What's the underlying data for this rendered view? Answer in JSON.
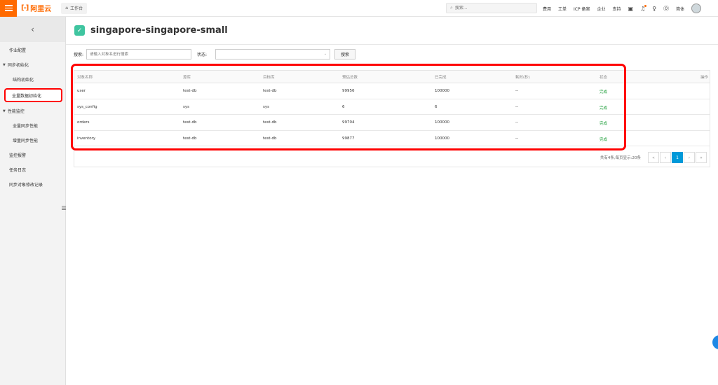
{
  "topbar": {
    "brand": "阿里云",
    "brand_icon": "[-]",
    "workbench": "工作台",
    "search_placeholder": "搜索...",
    "nav": [
      "费用",
      "工单",
      "ICP 备案",
      "企业",
      "支持"
    ],
    "user": "简体",
    "accent": "#ff6a00"
  },
  "sidebar": {
    "items": [
      {
        "label": "作业配置"
      },
      {
        "label": "同步初始化"
      },
      {
        "label": "结构初始化"
      },
      {
        "label": "全量数据初始化"
      },
      {
        "label": "性能监控"
      },
      {
        "label": "全量同步性能"
      },
      {
        "label": "增量同步性能"
      },
      {
        "label": "监控报警"
      },
      {
        "label": "任务日志"
      },
      {
        "label": "同步对象修改记录"
      }
    ]
  },
  "main": {
    "title": "singapore-singapore-small",
    "filters": {
      "search_label": "搜索:",
      "search_placeholder": "请输入对象名进行搜索",
      "status_label": "状态:",
      "status_value": "",
      "search_button": "搜索"
    },
    "table": {
      "headers": [
        "对象名称",
        "源库",
        "目标库",
        "预估总数",
        "已完成",
        "耗时(秒)",
        "状态",
        "操作"
      ],
      "rows": [
        {
          "name": "user",
          "source": "test-db",
          "target": "test-db",
          "estimated": "99956",
          "done": "100000",
          "time": "--",
          "status": "完成"
        },
        {
          "name": "sys_config",
          "source": "sys",
          "target": "sys",
          "estimated": "6",
          "done": "6",
          "time": "--",
          "status": "完成"
        },
        {
          "name": "orders",
          "source": "test-db",
          "target": "test-db",
          "estimated": "99704",
          "done": "100000",
          "time": "--",
          "status": "完成"
        },
        {
          "name": "inventory",
          "source": "test-db",
          "target": "test-db",
          "estimated": "99877",
          "done": "100000",
          "time": "--",
          "status": "完成"
        }
      ]
    },
    "pagination": {
      "summary": "共有4条,每页显示:20条",
      "first": "«",
      "prev": "‹",
      "current": "1",
      "next": "›",
      "last": "»"
    }
  }
}
